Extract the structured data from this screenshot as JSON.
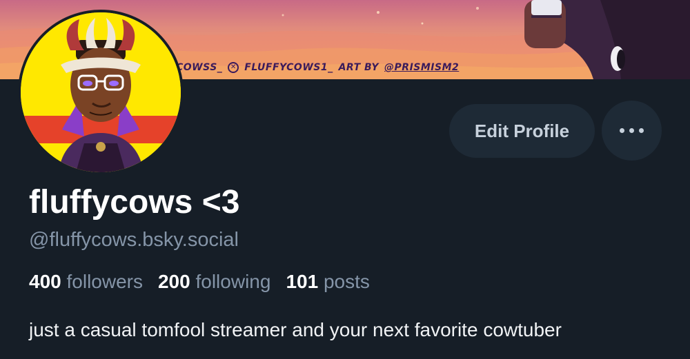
{
  "banner": {
    "credit_parts": [
      {
        "text": "COWSS_",
        "underline": false
      },
      {
        "text": "FLUFFYCOWS1_",
        "underline": false,
        "icon": "x-logo-icon"
      },
      {
        "text": "ART BY",
        "underline": false
      },
      {
        "text": "@PRISMISM2",
        "underline": true
      }
    ]
  },
  "profile": {
    "display_name": "fluffycows <3",
    "handle": "@fluffycows.bsky.social",
    "bio": "just a casual tomfool streamer and your next favorite cowtuber"
  },
  "stats": [
    {
      "value": "400",
      "label": "followers"
    },
    {
      "value": "200",
      "label": "following"
    },
    {
      "value": "101",
      "label": "posts"
    }
  ],
  "actions": {
    "edit_label": "Edit Profile",
    "more_icon": "ellipsis-icon"
  },
  "colors": {
    "background": "#161e27",
    "button_bg": "#1e2a36",
    "muted_text": "#8595a8",
    "banner_text": "#3a1a5c"
  }
}
